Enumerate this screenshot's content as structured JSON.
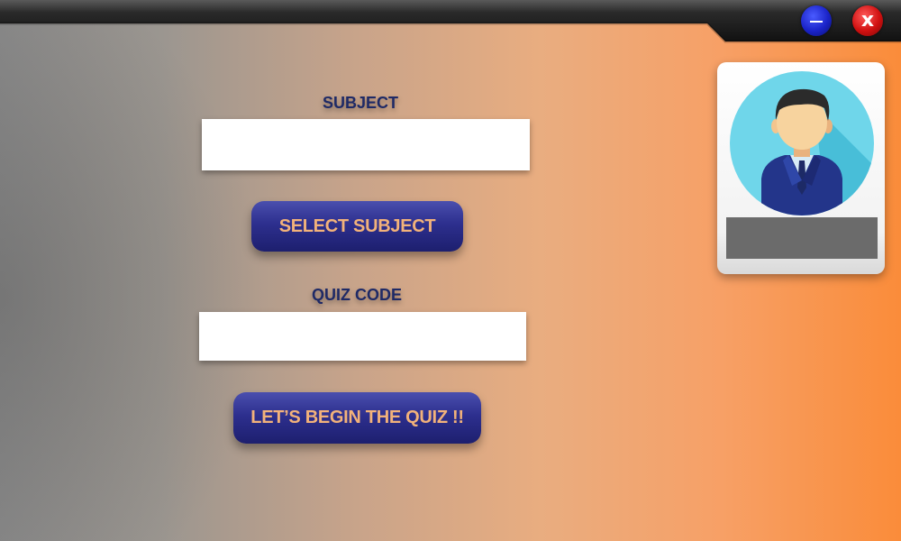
{
  "window": {
    "minimize_icon": "minimize-icon",
    "close_icon": "close-icon",
    "close_label": "x"
  },
  "form": {
    "subject_label": "SUBJECT",
    "subject_value": "",
    "select_subject_label": "SELECT SUBJECT",
    "quiz_code_label": "QUIZ CODE",
    "quiz_code_value": "",
    "begin_label": "LET’S BEGIN THE QUIZ !!"
  },
  "profile": {
    "avatar_icon": "user-avatar-icon",
    "name": ""
  },
  "colors": {
    "button_blue": "#2d2f8e",
    "button_text": "#f2b27a",
    "label_navy": "#1f2a66",
    "avatar_bg": "#6fd6ea"
  }
}
